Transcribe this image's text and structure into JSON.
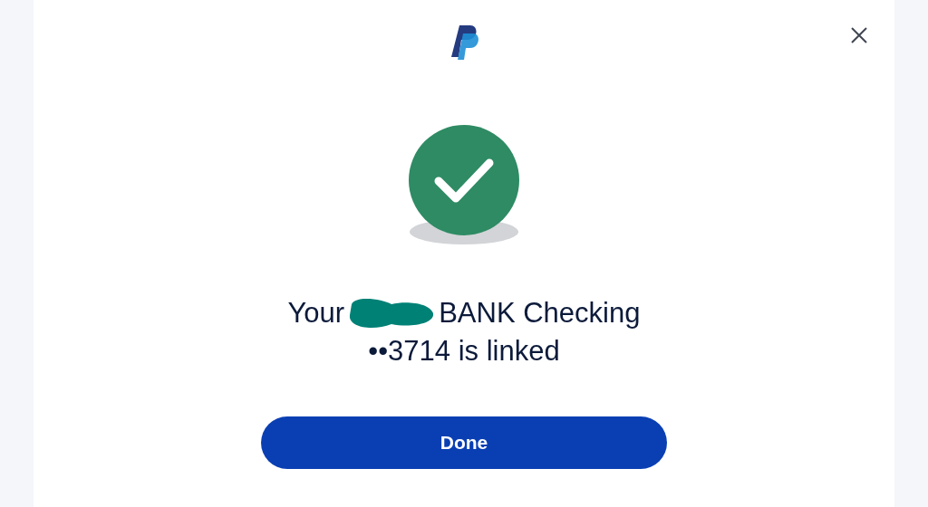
{
  "message": {
    "lead": "Your",
    "redacted": true,
    "rest": "BANK Checking",
    "line_2": "••3714 is linked"
  },
  "button": {
    "label": "Done"
  }
}
